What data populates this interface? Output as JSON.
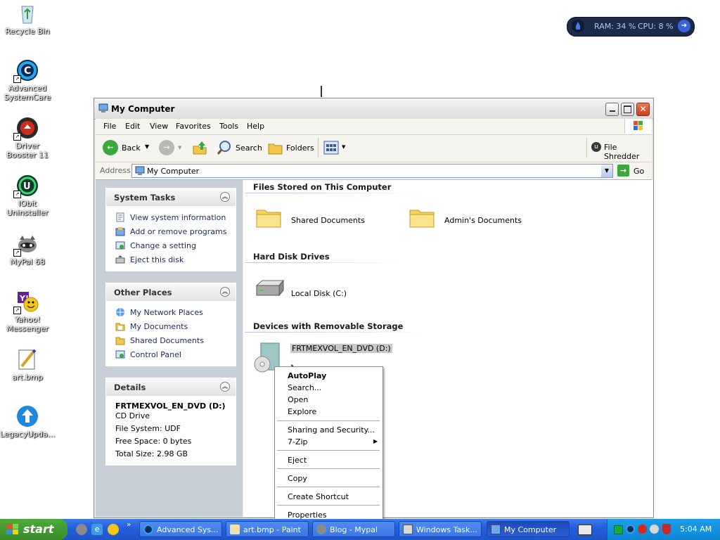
{
  "desktop": {
    "icons": [
      {
        "label": "Recycle Bin"
      },
      {
        "label": "Advanced SystemCare"
      },
      {
        "label": "Driver Booster 11"
      },
      {
        "label": "IObit Uninstaller"
      },
      {
        "label": "MyPal 68"
      },
      {
        "label": "Yahoo! Messenger"
      },
      {
        "label": "art.bmp"
      },
      {
        "label": "LegacyUpda..."
      }
    ],
    "widget": {
      "ram": "RAM: 34 %",
      "cpu": "CPU: 8 %"
    }
  },
  "window": {
    "title": "My Computer",
    "menu": [
      "File",
      "Edit",
      "View",
      "Favorites",
      "Tools",
      "Help"
    ],
    "toolbar": {
      "back": "Back",
      "search": "Search",
      "folders": "Folders",
      "file_shredder": "File Shredder"
    },
    "address": {
      "label": "Address",
      "value": "My Computer",
      "go": "Go"
    },
    "system_tasks": {
      "title": "System Tasks",
      "items": [
        "View system information",
        "Add or remove programs",
        "Change a setting",
        "Eject this disk"
      ]
    },
    "other_places": {
      "title": "Other Places",
      "items": [
        "My Network Places",
        "My Documents",
        "Shared Documents",
        "Control Panel"
      ]
    },
    "details": {
      "title": "Details",
      "name": "FRTMEXVOL_EN_DVD (D:)",
      "type": "CD Drive",
      "fs": "File System: UDF",
      "free": "Free Space: 0 bytes",
      "total": "Total Size: 2.98 GB"
    },
    "sections": {
      "files": {
        "title": "Files Stored on This Computer",
        "items": [
          "Shared Documents",
          "Admin's Documents"
        ]
      },
      "hdd": {
        "title": "Hard Disk Drives",
        "items": [
          "Local Disk (C:)"
        ]
      },
      "removable": {
        "title": "Devices with Removable Storage",
        "items": [
          "FRTMEXVOL_EN_DVD (D:)"
        ]
      }
    }
  },
  "context_menu": {
    "items": [
      "AutoPlay",
      "Search...",
      "Open",
      "Explore",
      "Sharing and Security...",
      "7-Zip",
      "Eject",
      "Copy",
      "Create Shortcut",
      "Properties"
    ]
  },
  "taskbar": {
    "start": "start",
    "tasks": [
      "Advanced Sys...",
      "art.bmp - Paint",
      "Blog - Mypal",
      "Windows Task...",
      "My Computer"
    ],
    "clock": "5:04 AM"
  }
}
